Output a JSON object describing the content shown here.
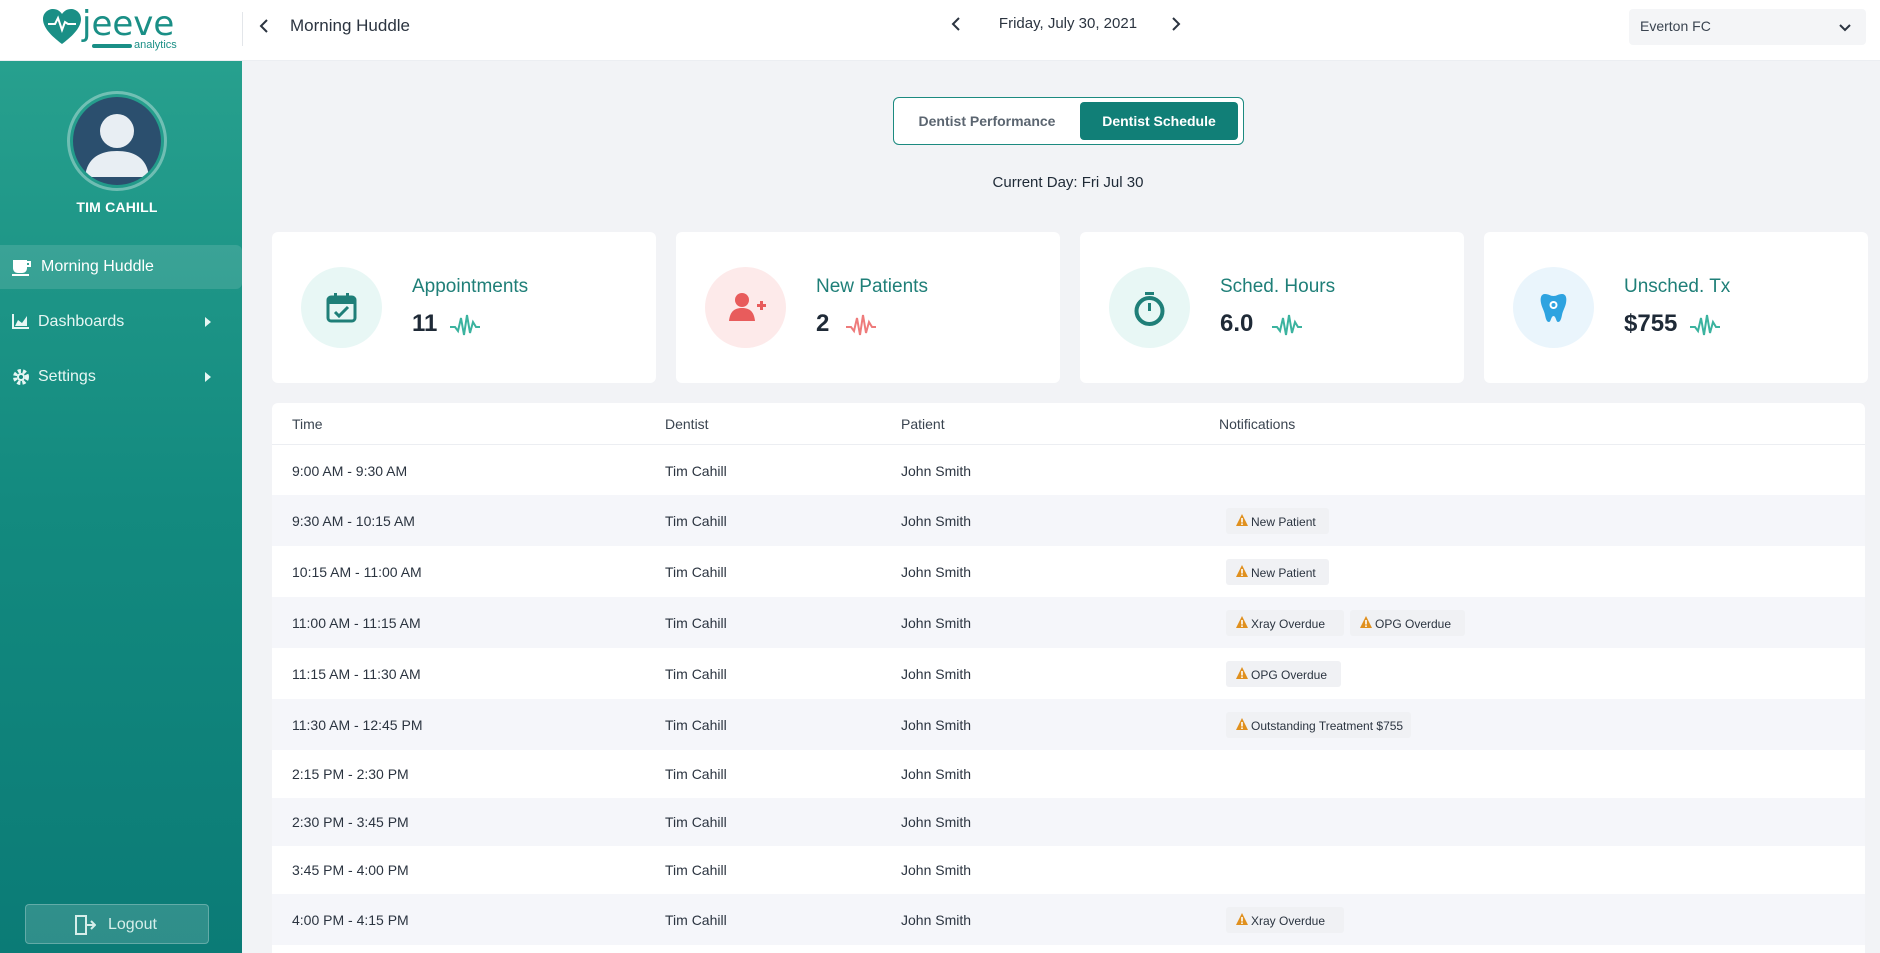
{
  "brand": {
    "name": "jeeve",
    "sub": "analytics",
    "color": "#1a8f86"
  },
  "header": {
    "page_title": "Morning Huddle",
    "date": "Friday, July 30, 2021",
    "club": "Everton FC"
  },
  "user": {
    "name": "TIM CAHILL"
  },
  "sidebar": {
    "items": [
      {
        "label": "Morning Huddle",
        "icon": "coffee-cup-icon",
        "active": true
      },
      {
        "label": "Dashboards",
        "icon": "area-chart-icon"
      },
      {
        "label": "Settings",
        "icon": "gear-icon"
      }
    ],
    "logout_label": "Logout"
  },
  "toggle": {
    "performance_label": "Dentist Performance",
    "schedule_label": "Dentist Schedule",
    "selected": "Dentist Schedule"
  },
  "current_day": "Current Day: Fri Jul 30",
  "kpis": [
    {
      "title": "Appointments",
      "value": "11",
      "icon": "calendar-check-icon",
      "accent": "#1f8f87"
    },
    {
      "title": "New Patients",
      "value": "2",
      "icon": "user-plus-icon",
      "accent": "#e85c5c"
    },
    {
      "title": "Sched. Hours",
      "value": "6.0",
      "icon": "stopwatch-icon",
      "accent": "#1f8f87"
    },
    {
      "title": "Unsched. Tx",
      "value": "$755",
      "icon": "tooth-icon",
      "accent": "#2ea3e0"
    }
  ],
  "table": {
    "columns": [
      "Time",
      "Dentist",
      "Patient",
      "Notifications"
    ],
    "rows": [
      {
        "time": "9:00 AM - 9:30 AM",
        "dentist": "Tim Cahill",
        "patient": "John Smith",
        "notifications": []
      },
      {
        "time": "9:30 AM - 10:15 AM",
        "dentist": "Tim Cahill",
        "patient": "John Smith",
        "notifications": [
          "New Patient"
        ]
      },
      {
        "time": "10:15 AM - 11:00 AM",
        "dentist": "Tim Cahill",
        "patient": "John Smith",
        "notifications": [
          "New Patient"
        ]
      },
      {
        "time": "11:00 AM - 11:15 AM",
        "dentist": "Tim Cahill",
        "patient": "John Smith",
        "notifications": [
          "Xray Overdue",
          "OPG Overdue"
        ]
      },
      {
        "time": "11:15 AM - 11:30 AM",
        "dentist": "Tim Cahill",
        "patient": "John Smith",
        "notifications": [
          "OPG Overdue"
        ]
      },
      {
        "time": "11:30 AM - 12:45 PM",
        "dentist": "Tim Cahill",
        "patient": "John Smith",
        "notifications": [
          "Outstanding Treatment $755"
        ]
      },
      {
        "time": "2:15 PM - 2:30 PM",
        "dentist": "Tim Cahill",
        "patient": "John Smith",
        "notifications": []
      },
      {
        "time": "2:30 PM - 3:45 PM",
        "dentist": "Tim Cahill",
        "patient": "John Smith",
        "notifications": []
      },
      {
        "time": "3:45 PM - 4:00 PM",
        "dentist": "Tim Cahill",
        "patient": "John Smith",
        "notifications": []
      },
      {
        "time": "4:00 PM - 4:15 PM",
        "dentist": "Tim Cahill",
        "patient": "John Smith",
        "notifications": [
          "Xray Overdue"
        ]
      }
    ]
  },
  "colors": {
    "warning": "#e0901e",
    "sidebar_top": "#27a08e",
    "sidebar_bottom": "#0b7b76"
  }
}
